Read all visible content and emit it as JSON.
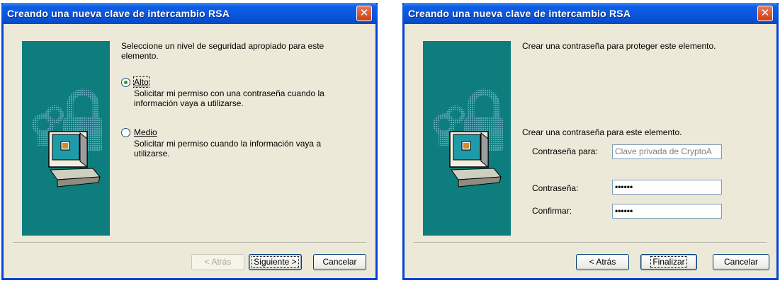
{
  "left_dialog": {
    "title": "Creando una nueva clave de intercambio RSA",
    "close_label": "✕",
    "intro": "Seleccione un nivel de seguridad apropiado para este",
    "intro_line2": "elemento.",
    "options": [
      {
        "label": "Alto",
        "description_line1": "Solicitar mi permiso con una contraseña cuando la",
        "description_line2": "información vaya a utilizarse.",
        "selected": true
      },
      {
        "label": "Medio",
        "description_line1": "Solicitar mi permiso cuando la información vaya a",
        "description_line2": "utilizarse.",
        "selected": false
      }
    ],
    "buttons": {
      "back": "< Atrás",
      "next": "Siguiente >",
      "cancel": "Cancelar"
    }
  },
  "right_dialog": {
    "title": "Creando una nueva clave de intercambio RSA",
    "close_label": "✕",
    "intro": "Crear una contraseña para proteger este elemento.",
    "section_heading": "Crear una contraseña para este elemento.",
    "password_for_label": "Contraseña para:",
    "password_for_value": "Clave privada de CryptoA",
    "password_label": "Contraseña:",
    "password_value": "••••••",
    "confirm_label": "Confirmar:",
    "confirm_value": "••••••",
    "buttons": {
      "back": "< Atrás",
      "finish": "Finalizar",
      "cancel": "Cancelar"
    }
  },
  "colors": {
    "titlebar": "#0a56dc",
    "dialog_bg": "#ece9d8",
    "side_panel": "#0e7d7d",
    "close_button": "#d9532f"
  },
  "icons": [
    "padlock-computer-icon",
    "close-icon"
  ]
}
